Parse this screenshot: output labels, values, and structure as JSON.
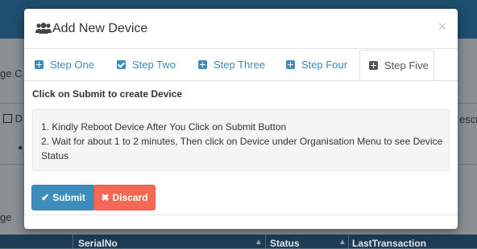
{
  "background": {
    "breadcrumb_fragment": "ge C",
    "row_checkbox_label": "D",
    "right_fragment": "escr",
    "left_fragment": "ge",
    "table_headers": [
      "SerialNo",
      "Status",
      "LastTransaction"
    ]
  },
  "modal": {
    "title": "Add New Device",
    "close_glyph": "×",
    "tabs": [
      {
        "label": "Step One",
        "icon": "plus-square-icon"
      },
      {
        "label": "Step Two",
        "icon": "check-square-icon"
      },
      {
        "label": "Step Three",
        "icon": "plus-square-icon"
      },
      {
        "label": "Step Four",
        "icon": "plus-square-icon"
      },
      {
        "label": "Step Five",
        "icon": "plus-square-icon",
        "active": true
      }
    ],
    "step_title": "Click on Submit to create Device",
    "instructions": [
      "1. Kindly Reboot Device After You Click on Submit Button",
      "2. Wait for about 1 to 2 minutes, Then click on Device under Organisation Menu to see Device Status"
    ],
    "buttons": {
      "submit_label": "Submit",
      "discard_label": "Discard"
    }
  },
  "colors": {
    "primary": "#3c8dbc",
    "danger": "#f56954",
    "header_bg": "#1f4f6e"
  }
}
